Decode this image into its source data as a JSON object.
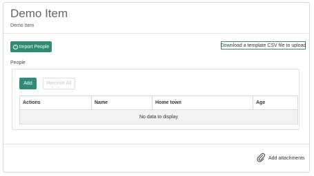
{
  "header": {
    "title": "Demo Item",
    "subtitle": "Demo Item"
  },
  "actions": {
    "import_label": "Import People",
    "download_label": "Download a template CSV file to upload"
  },
  "people": {
    "label": "People",
    "add_label": "Add",
    "remove_all_label": "Remove All",
    "columns": [
      "Actions",
      "Name",
      "Home town",
      "Age"
    ],
    "empty_text": "No data to display"
  },
  "footer": {
    "attach_label": "Add attachments"
  },
  "colors": {
    "accent": "#2e8b74"
  }
}
